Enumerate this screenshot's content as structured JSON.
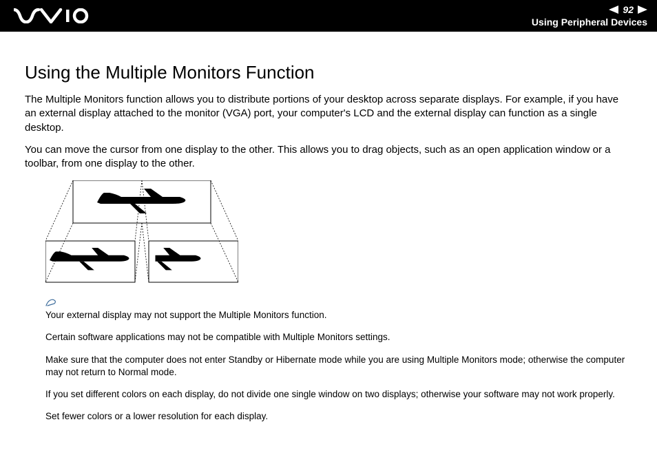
{
  "header": {
    "page_number": "92",
    "section": "Using Peripheral Devices"
  },
  "content": {
    "title": "Using the Multiple Monitors Function",
    "para1": "The Multiple Monitors function allows you to distribute portions of your desktop across separate displays. For example, if you have an external display attached to the monitor (VGA) port, your computer's LCD and the external display can function as a single desktop.",
    "para2": "You can move the cursor from one display to the other. This allows you to drag objects, such as an open application window or a toolbar, from one display to the other."
  },
  "notes": {
    "n1": "Your external display may not support the Multiple Monitors function.",
    "n2": "Certain software applications may not be compatible with Multiple Monitors settings.",
    "n3": "Make sure that the computer does not enter Standby or Hibernate mode while you are using Multiple Monitors mode; otherwise the computer may not return to Normal mode.",
    "n4": "If you set different colors on each display, do not divide one single window on two displays; otherwise your software may not work properly.",
    "n5": "Set fewer colors or a lower resolution for each display."
  }
}
